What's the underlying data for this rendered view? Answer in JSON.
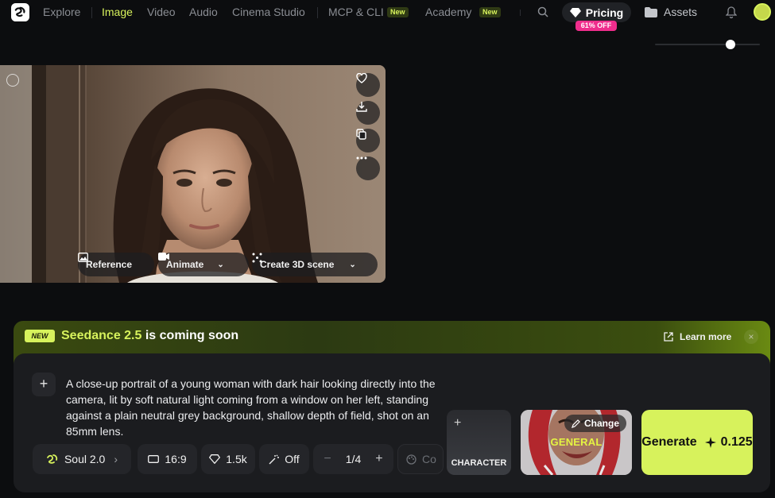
{
  "nav": {
    "items": [
      {
        "label": "Explore"
      },
      {
        "label": "Image"
      },
      {
        "label": "Video"
      },
      {
        "label": "Audio"
      },
      {
        "label": "Cinema Studio"
      },
      {
        "label": "MCP & CLI",
        "badge": "New"
      },
      {
        "label": "Academy",
        "badge": "New"
      }
    ],
    "pricing_label": "Pricing",
    "discount_badge": "61% OFF",
    "assets_label": "Assets",
    "accent_color": "#d7f25c",
    "slider_value": 0.72
  },
  "photo": {
    "actions": {
      "reference_label": "Reference",
      "animate_label": "Animate",
      "create3d_label": "Create 3D scene"
    },
    "side_icons": [
      "heart-icon",
      "download-icon",
      "copy-icon",
      "more-icon"
    ]
  },
  "banner": {
    "tag": "NEW",
    "title_highlight": "Seedance 2.5",
    "title_rest": " is coming soon",
    "learn_more": "Learn more",
    "close": "×"
  },
  "composer": {
    "prompt": "A close-up portrait of a young woman with dark hair looking directly into the camera, lit by soft natural light coming from a window on her left, standing against a plain neutral grey background, shallow depth of field, shot on an 85mm lens.",
    "model_label": "Soul 2.0",
    "aspect_label": "16:9",
    "quality_label": "1.5k",
    "enhance_label": "Off",
    "count_label": "1/4",
    "color_label": "Co",
    "character_label": "CHARACTER",
    "change_label": "Change",
    "style_label": "GENERAL",
    "generate_label": "Generate",
    "generate_cost": "0.125"
  }
}
